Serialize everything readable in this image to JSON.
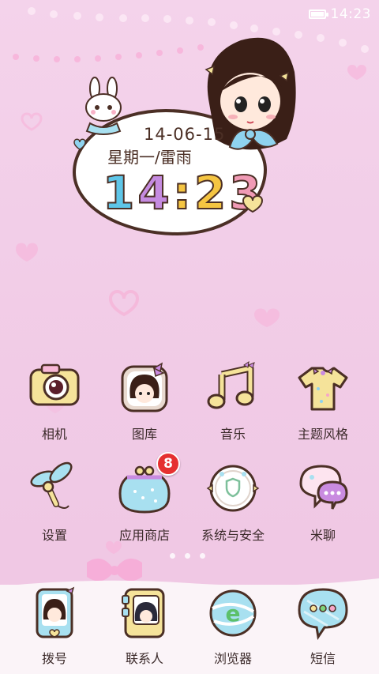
{
  "status_bar": {
    "time": "14:23"
  },
  "widget": {
    "date": "14-06-15",
    "weekday_weather": "星期一/雷雨",
    "time_chars": [
      "1",
      "4",
      ":",
      "2",
      "3"
    ],
    "digit_colors": [
      "#5ec6e8",
      "#c58be0",
      "#f5c542",
      "#f09ab5",
      "#7dd37a"
    ]
  },
  "apps": [
    {
      "label": "相机",
      "icon": "camera-icon"
    },
    {
      "label": "图库",
      "icon": "gallery-icon"
    },
    {
      "label": "音乐",
      "icon": "music-note-icon"
    },
    {
      "label": "主题风格",
      "icon": "tshirt-theme-icon"
    },
    {
      "label": "设置",
      "icon": "dragonfly-settings-icon"
    },
    {
      "label": "应用商店",
      "icon": "purse-store-icon",
      "badge": "8"
    },
    {
      "label": "系统与安全",
      "icon": "shield-security-icon"
    },
    {
      "label": "米聊",
      "icon": "chat-bubbles-icon"
    }
  ],
  "dock": [
    {
      "label": "拨号",
      "icon": "phone-dialer-icon"
    },
    {
      "label": "联系人",
      "icon": "contacts-book-icon"
    },
    {
      "label": "浏览器",
      "icon": "browser-ball-icon"
    },
    {
      "label": "短信",
      "icon": "message-bubble-icon"
    }
  ],
  "pager": {
    "pages": 3,
    "current": 1
  },
  "colors": {
    "wallpaper": "#f3cfe8",
    "widget_border": "#4b2f25",
    "badge": "#e53030"
  }
}
